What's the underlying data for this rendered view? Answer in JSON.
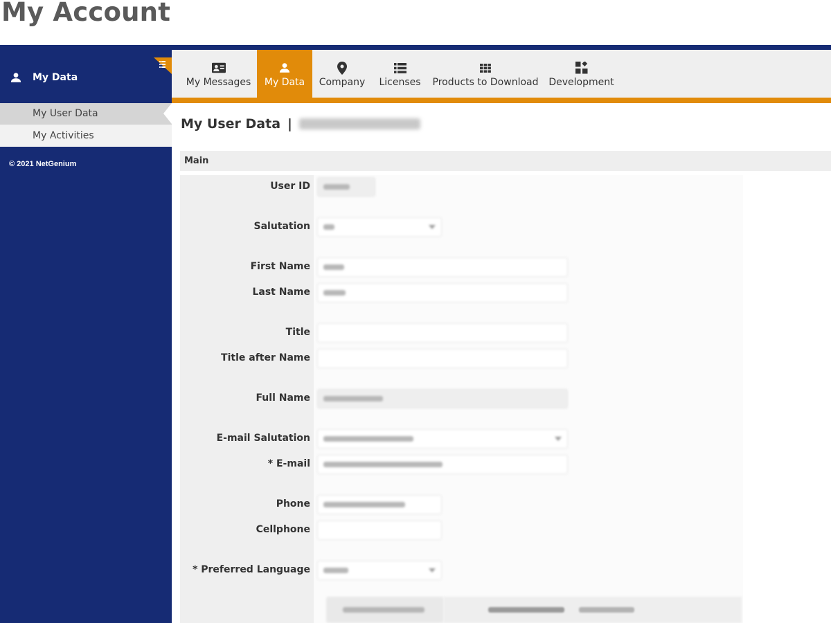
{
  "page": {
    "title": "My Account"
  },
  "tabs": [
    {
      "label": "My Messages",
      "icon": "contact-card-icon"
    },
    {
      "label": "My Data",
      "icon": "user-icon",
      "active": true
    },
    {
      "label": "Company",
      "icon": "map-pin-icon"
    },
    {
      "label": "Licenses",
      "icon": "list-icon"
    },
    {
      "label": "Products to Download",
      "icon": "grid-icon"
    },
    {
      "label": "Development",
      "icon": "widgets-icon"
    }
  ],
  "sidebar": {
    "header": "My Data",
    "header_icon": "user-icon",
    "items": [
      {
        "label": "My User Data",
        "active": true
      },
      {
        "label": "My Activities"
      }
    ],
    "copyright": "© 2021 NetGenium"
  },
  "content": {
    "section_title": "My User Data",
    "section_separator": "|",
    "group_header": "Main",
    "fields": [
      {
        "label": "User ID"
      },
      {
        "label": "Salutation"
      },
      {
        "label": "First Name"
      },
      {
        "label": "Last Name"
      },
      {
        "label": "Title"
      },
      {
        "label": "Title after Name"
      },
      {
        "label": "Full Name"
      },
      {
        "label": "E-mail Salutation"
      },
      {
        "label": "* E-mail"
      },
      {
        "label": "Phone"
      },
      {
        "label": "Cellphone"
      },
      {
        "label": "* Preferred Language"
      }
    ]
  },
  "colors": {
    "navy": "#162b74",
    "orange": "#e18b0a",
    "tab_bar": "#efefef",
    "title_grey": "#5a5a5a"
  }
}
